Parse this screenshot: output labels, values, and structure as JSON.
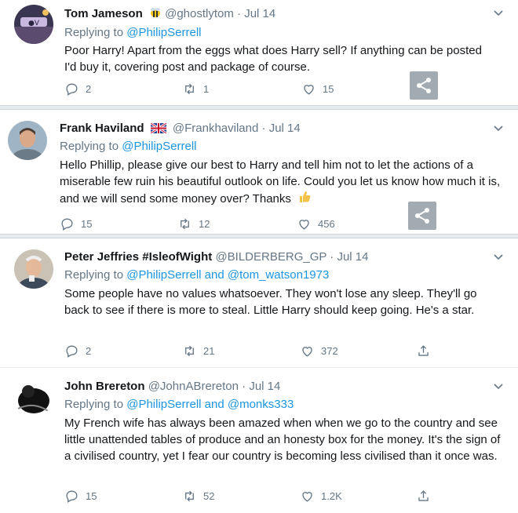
{
  "tweets": [
    {
      "name": "Tom Jameson",
      "badge_icon": "bee-emoji",
      "handle": "@ghostlytom",
      "date": "Jul 14",
      "replying_label": "Replying to",
      "replying_to": "@PhilipSerrell",
      "replying_and": "",
      "replying_to_2": "",
      "text": "Poor Harry! Apart from the eggs what does Harry sell? If anything can be posted I'd buy it, covering post and package of course.",
      "replies": "2",
      "retweets": "1",
      "likes": "15"
    },
    {
      "name": "Frank Haviland",
      "badge_icon": "uk-flag-emoji",
      "handle": "@Frankhaviland",
      "date": "Jul 14",
      "replying_label": "Replying to",
      "replying_to": "@PhilipSerrell",
      "replying_and": "",
      "replying_to_2": "",
      "text": "Hello Phillip, please give our best to Harry and tell him not to let the actions of a miserable few ruin his beautiful outlook on life. Could you let us know how much it is, and we will send some money over? Thanks",
      "replies": "15",
      "retweets": "12",
      "likes": "456"
    },
    {
      "name": "Peter Jeffries #IsleofWight",
      "handle": "@BILDERBERG_GP",
      "date": "Jul 14",
      "replying_label": "Replying to",
      "replying_to": "@PhilipSerrell",
      "replying_and": "and",
      "replying_to_2": "@tom_watson1973",
      "text": "Some people have no values whatsoever. They won't lose any sleep. They'll go back to see if there is more to steal. Little Harry should keep going. He's a star.",
      "replies": "2",
      "retweets": "21",
      "likes": "372"
    },
    {
      "name": "John Brereton",
      "handle": "@JohnABrereton",
      "date": "Jul 14",
      "replying_label": "Replying to",
      "replying_to": "@PhilipSerrell",
      "replying_and": "and",
      "replying_to_2": "@monks333",
      "text": "My French wife has always been amazed when when we go to the country and see little unattended tables of produce and an honesty box for the money. It's the sign of a civilised country, yet I fear our country is becoming less civilised than it once was.",
      "replies": "15",
      "retweets": "52",
      "likes": "1.2K"
    }
  ],
  "separator": "·",
  "colors": {
    "link": "#1b95e0",
    "meta": "#657786",
    "text": "#14171a"
  }
}
